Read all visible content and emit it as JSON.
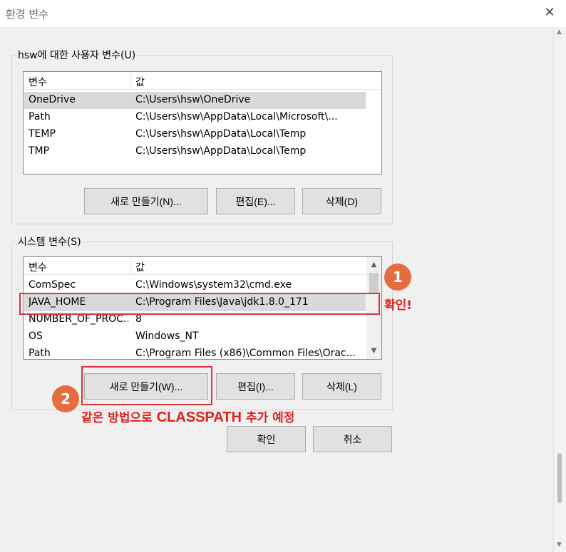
{
  "window": {
    "title": "환경 변수",
    "close_icon": "close-icon"
  },
  "user_vars": {
    "group_label": "hsw에 대한 사용자 변수(U)",
    "columns": [
      "변수",
      "값"
    ],
    "rows": [
      {
        "name": "OneDrive",
        "value": "C:\\Users\\hsw\\OneDrive",
        "selected": true
      },
      {
        "name": "Path",
        "value": "C:\\Users\\hsw\\AppData\\Local\\Microsoft\\..."
      },
      {
        "name": "TEMP",
        "value": "C:\\Users\\hsw\\AppData\\Local\\Temp"
      },
      {
        "name": "TMP",
        "value": "C:\\Users\\hsw\\AppData\\Local\\Temp"
      }
    ],
    "new_label": "새로 만들기(N)...",
    "edit_label": "편집(E)...",
    "delete_label": "삭제(D)"
  },
  "system_vars": {
    "group_label": "시스템 변수(S)",
    "columns": [
      "변수",
      "값"
    ],
    "rows": [
      {
        "name": "ComSpec",
        "value": "C:\\Windows\\system32\\cmd.exe"
      },
      {
        "name": "JAVA_HOME",
        "value": "C:\\Program Files\\Java\\jdk1.8.0_171",
        "selected": true
      },
      {
        "name": "NUMBER_OF_PROC...",
        "value": "8"
      },
      {
        "name": "OS",
        "value": "Windows_NT"
      },
      {
        "name": "Path",
        "value": "C:\\Program Files (x86)\\Common Files\\Orac..."
      }
    ],
    "new_label": "새로 만들기(W)...",
    "edit_label": "편집(I)...",
    "delete_label": "삭제(L)"
  },
  "dialog_buttons": {
    "ok_label": "확인",
    "cancel_label": "취소"
  },
  "annotations": {
    "badge1": "1",
    "badge1_text": "확인!",
    "badge2": "2",
    "badge2_text_a": "같은 방법으로 ",
    "badge2_text_b": "CLASSPATH",
    "badge2_text_c": " 추가 예정",
    "accent_color": "#e0211d",
    "badge_color": "#e46c3f"
  }
}
